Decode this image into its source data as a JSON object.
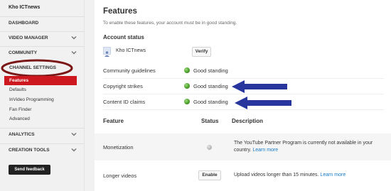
{
  "sidebar": {
    "user_name": "Kho ICTnews",
    "dashboard": "DASHBOARD",
    "video_manager": "VIDEO MANAGER",
    "community": "COMMUNITY",
    "channel_settings": "CHANNEL SETTINGS",
    "subitems": [
      "Features",
      "Defaults",
      "InVideo Programming",
      "Fan Finder",
      "Advanced"
    ],
    "analytics": "ANALYTICS",
    "creation_tools": "CREATION TOOLS",
    "send_feedback": "Send feedback"
  },
  "main": {
    "title": "Features",
    "subtitle": "To enable these features, your account must be in good standing.",
    "account_status_label": "Account status",
    "account_name": "Kho ICTnews",
    "verify_label": "Verify",
    "status_rows": [
      {
        "label": "Community guidelines",
        "value": "Good standing"
      },
      {
        "label": "Copyright strikes",
        "value": "Good standing"
      },
      {
        "label": "Content ID claims",
        "value": "Good standing"
      }
    ],
    "table": {
      "headers": {
        "feature": "Feature",
        "status": "Status",
        "description": "Description"
      },
      "rows": [
        {
          "feature": "Monetization",
          "desc_text": "The YouTube Partner Program is currently not available in your country.",
          "desc_link": "Learn more"
        },
        {
          "feature": "Longer videos",
          "button": "Enable",
          "desc_text": "Upload videos longer than 15 minutes.",
          "desc_link": "Learn more"
        }
      ]
    }
  },
  "colors": {
    "accent_red": "#cc181e",
    "annotation_ring": "#7a1616",
    "annotation_arrow": "#27359c",
    "link_blue": "#167ac6",
    "good_green": "#4ea02c"
  }
}
